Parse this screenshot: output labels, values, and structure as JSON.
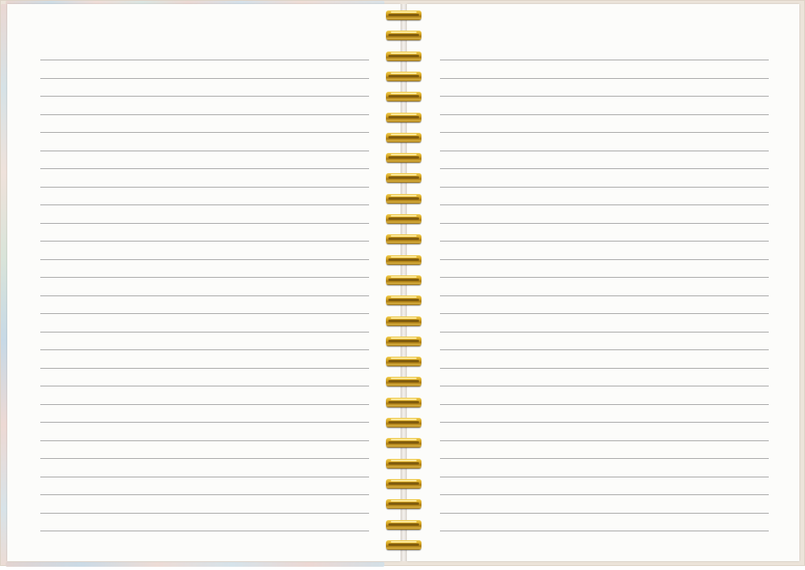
{
  "notebook": {
    "ruled_lines_per_page": 27,
    "ring_count": 27
  }
}
